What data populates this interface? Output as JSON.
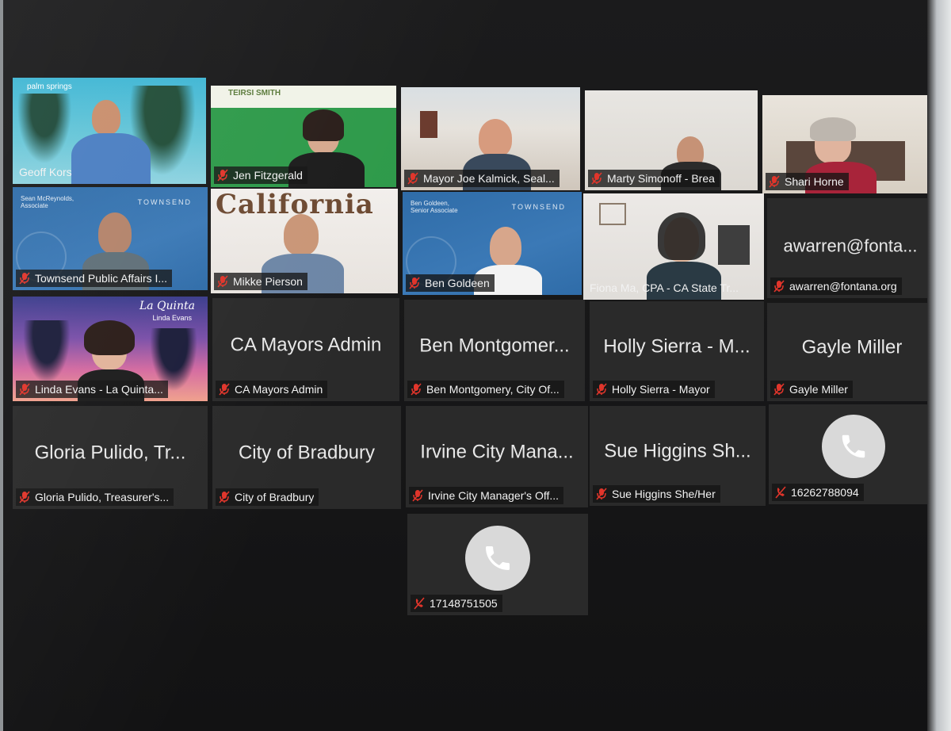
{
  "participants": [
    {
      "label": "Geoff Kors",
      "muted": false
    },
    {
      "label": "Jen Fitzgerald",
      "muted": true
    },
    {
      "label": "Mayor Joe Kalmick, Seal...",
      "muted": true
    },
    {
      "label": "Marty Simonoff - Brea",
      "muted": true
    },
    {
      "label": "Shari Horne",
      "muted": true
    },
    {
      "label": "Townsend Public Affairs I...",
      "muted": true
    },
    {
      "label": "Mikke Pierson",
      "muted": true
    },
    {
      "label": "Ben Goldeen",
      "muted": true
    },
    {
      "label": "Fiona Ma, CPA - CA State Tr...",
      "muted": false,
      "active_speaker": true
    },
    {
      "label": "awarren@fontana.org",
      "center": "awarren@fonta...",
      "muted": true
    },
    {
      "label": "Linda Evans - La Quinta...",
      "muted": true
    },
    {
      "label": "CA Mayors Admin",
      "center": "CA Mayors Admin",
      "muted": true
    },
    {
      "label": "Ben Montgomery, City Of...",
      "center": "Ben Montgomer...",
      "muted": true
    },
    {
      "label": "Holly Sierra - Mayor",
      "center": "Holly Sierra - M...",
      "muted": true
    },
    {
      "label": "Gayle Miller",
      "center": "Gayle Miller",
      "muted": true
    },
    {
      "label": "Gloria Pulido, Treasurer's...",
      "center": "Gloria Pulido, Tr...",
      "muted": true
    },
    {
      "label": "City of Bradbury",
      "center": "City of Bradbury",
      "muted": true
    },
    {
      "label": "Irvine City Manager's Off...",
      "center": "Irvine City Mana...",
      "muted": true
    },
    {
      "label": "Sue Higgins She/Her",
      "center": "Sue Higgins Sh...",
      "muted": true
    },
    {
      "label": "16262788094",
      "muted": true,
      "phone": true
    },
    {
      "label": "17148751505",
      "muted": true,
      "phone": true
    }
  ],
  "backgrounds": {
    "townsend_1_text": "Sean McReynolds, Associate",
    "townsend_2_text": "Ben Goldeen, Senior Associate",
    "townsend_brand": "TOWNSEND",
    "palm_springs_brand": "palm springs",
    "teresi_brand": "TEIRSI SMITH",
    "california_sign": "California",
    "la_quinta_brand": "La Quinta",
    "la_quinta_sub": "Linda Evans"
  },
  "colors": {
    "tile_bg": "#2a2a2a",
    "active_border": "#c8d14a",
    "muted_icon": "#e0352b",
    "label_text": "#f2f2f2"
  }
}
